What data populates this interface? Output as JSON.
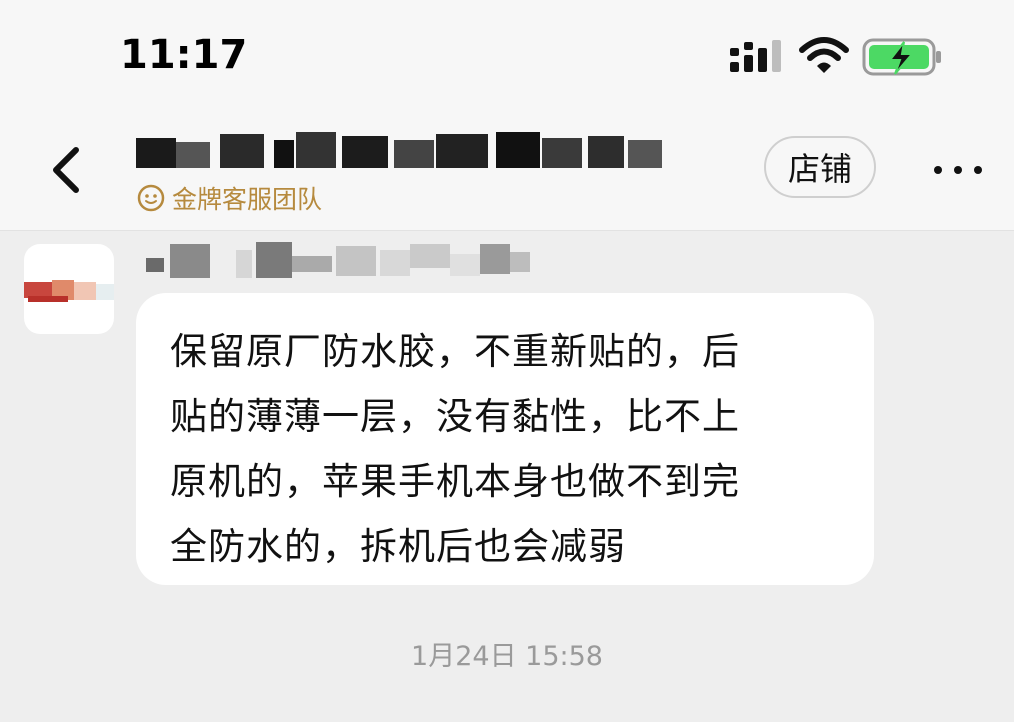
{
  "status_bar": {
    "time": "11:17",
    "icons": [
      "signal-icon",
      "wifi-icon",
      "battery-charging-icon"
    ],
    "battery_color": "#4cd964"
  },
  "header": {
    "title_obscured": true,
    "badge_icon": "smiley-face-icon",
    "badge_text": "金牌客服团队",
    "badge_color": "#b68a3e",
    "store_button_label": "店铺",
    "back_icon": "chevron-left-icon",
    "more_icon": "more-dots-icon"
  },
  "message": {
    "sender_obscured": true,
    "lines": [
      "保留原厂防水胶，不重新贴的，后",
      "贴的薄薄一层，没有黏性，比不上",
      "原机的，苹果手机本身也做不到完",
      "全防水的，拆机后也会减弱"
    ]
  },
  "timestamp": "1月24日 15:58"
}
